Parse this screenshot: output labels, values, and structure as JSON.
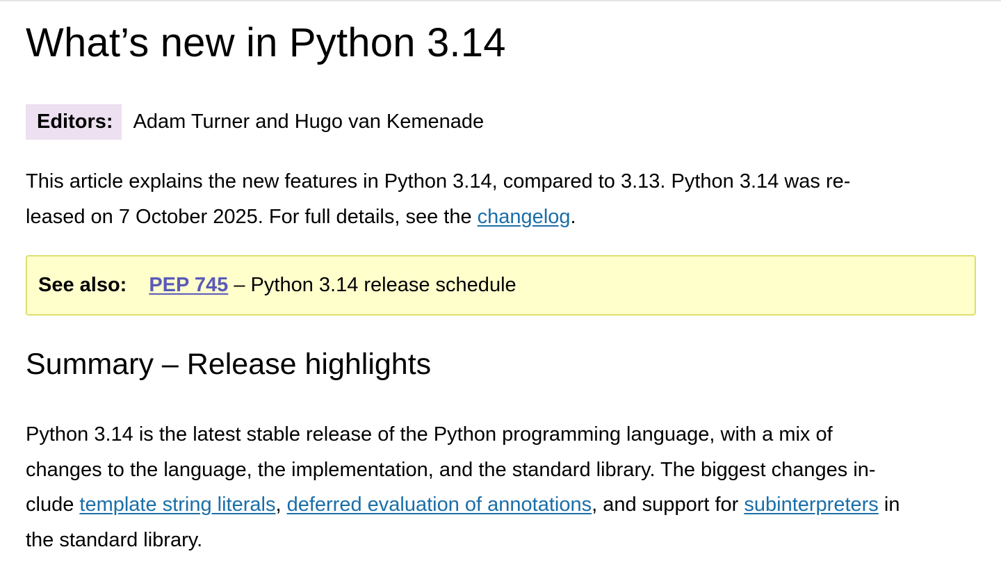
{
  "title": "What’s new in Python 3.14",
  "editors": {
    "label": "Editors:",
    "value": "Adam Turner and Hugo van Kemenade"
  },
  "intro": {
    "line1": "This article explains the new features in Python 3.14, compared to 3.13. Python 3.14 was re-",
    "line2_before": "leased on 7 October 2025. For full details, see the ",
    "link": "changelog",
    "line2_after": "."
  },
  "see_also": {
    "label": "See also:",
    "link": "PEP 745",
    "text": " – Python 3.14 release schedule"
  },
  "section": {
    "heading": "Summary – Release highlights",
    "line1": "Python 3.14 is the latest stable release of the Python programming language, with a mix of",
    "line2": "changes to the language, the implementation, and the standard library. The biggest changes in-",
    "line3_part1": "clude ",
    "link1": "template string literals",
    "line3_part2": ", ",
    "link2": "deferred evaluation of annotations",
    "line3_part3": ", and support for ",
    "link3": "subinterpreters",
    "line3_part4": " in",
    "line4": "the standard library."
  }
}
